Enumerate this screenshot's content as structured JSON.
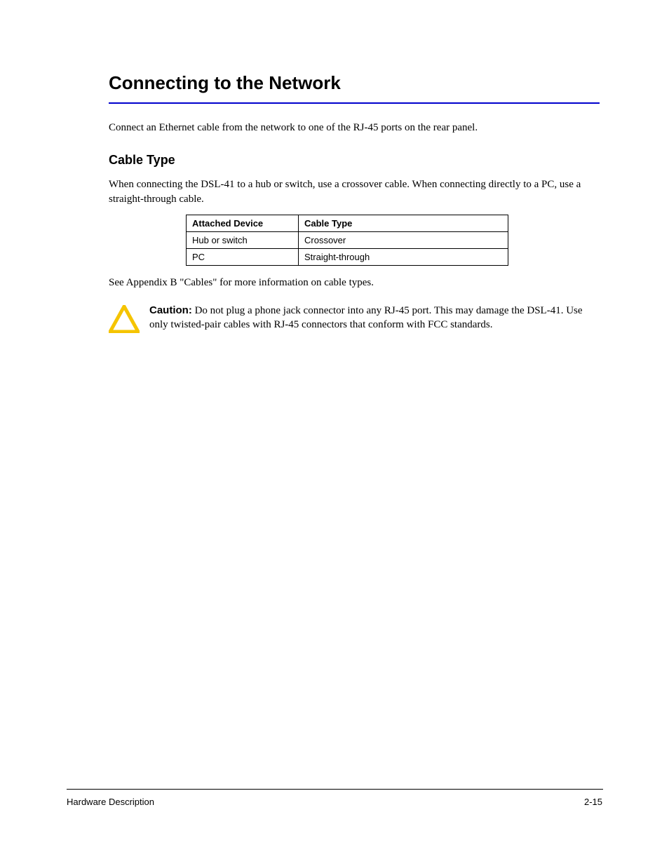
{
  "section": {
    "title": "Connecting to the Network",
    "rule_color": "#0000cc",
    "intro": "Connect an Ethernet cable from the network to one of the RJ-45 ports on the rear panel."
  },
  "cabletype": {
    "title": "Cable Type",
    "para1": "When connecting the DSL-41 to a hub or switch, use a crossover cable. When connecting directly to a PC, use a straight-through cable.",
    "table": {
      "headers": [
        "Attached Device",
        "Cable Type"
      ],
      "rows": [
        [
          "Hub or switch",
          "Crossover"
        ],
        [
          "PC",
          "Straight-through"
        ]
      ]
    },
    "para2": "See Appendix B \"Cables\" for more information on cable types."
  },
  "caution": {
    "label": "Caution:",
    "text": "Do not plug a phone jack connector into any RJ-45 port. This may damage the DSL-41. Use only twisted-pair cables with RJ-45 connectors that conform with FCC standards."
  },
  "footer": {
    "left": "Hardware Description",
    "right": "2-15"
  }
}
